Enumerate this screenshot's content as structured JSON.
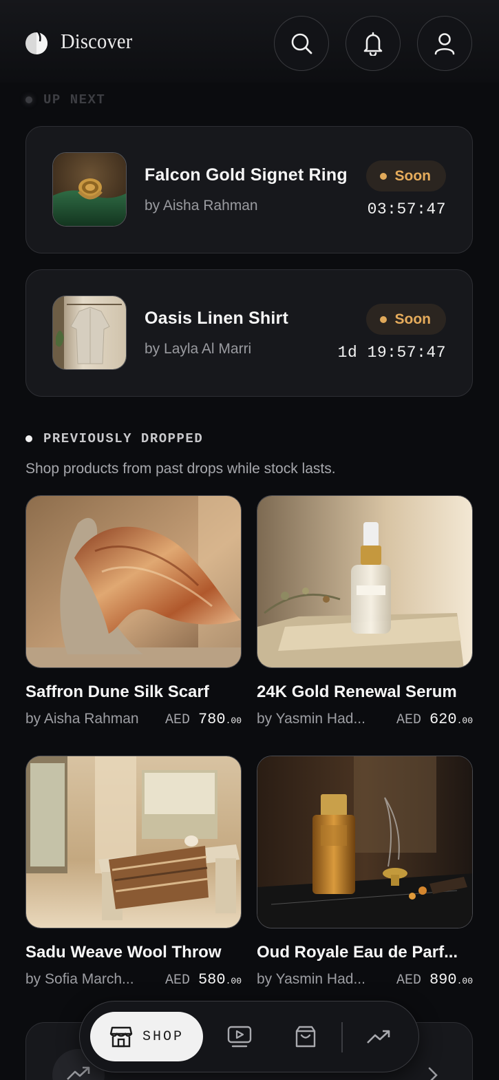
{
  "header": {
    "title": "Discover",
    "icons": {
      "logo": "moon-logo",
      "search": "search-icon",
      "notifications": "bell-icon",
      "profile": "user-icon"
    }
  },
  "up_next": {
    "label": "UP NEXT",
    "items": [
      {
        "title": "Falcon Gold Signet Ring",
        "by": "by Aisha Rahman",
        "badge": "Soon",
        "countdown": "03:57:47"
      },
      {
        "title": "Oasis Linen Shirt",
        "by": "by Layla Al Marri",
        "badge": "Soon",
        "countdown": "1d 19:57:47"
      }
    ]
  },
  "previously_dropped": {
    "label": "PREVIOUSLY DROPPED",
    "subtitle": "Shop products from past drops while stock lasts.",
    "products": [
      {
        "name": "Saffron Dune Silk Scarf",
        "by": "by Aisha Rahman",
        "currency": "AED",
        "price": "780",
        "cents": ".00"
      },
      {
        "name": "24K Gold Renewal Serum",
        "by": "by Yasmin Had...",
        "currency": "AED",
        "price": "620",
        "cents": ".00"
      },
      {
        "name": "Sadu Weave Wool Throw",
        "by": "by Sofia March...",
        "currency": "AED",
        "price": "580",
        "cents": ".00"
      },
      {
        "name": "Oud Royale Eau de Parf...",
        "by": "by Yasmin Had...",
        "currency": "AED",
        "price": "890",
        "cents": ".00"
      }
    ]
  },
  "nav": {
    "shop_label": "SHOP",
    "icons": [
      "store-icon",
      "video-icon",
      "shopping-bag-icon",
      "trending-icon"
    ]
  },
  "colors": {
    "background": "#0b0c0f",
    "card": "#17181c",
    "accent": "#e6ac5c"
  }
}
